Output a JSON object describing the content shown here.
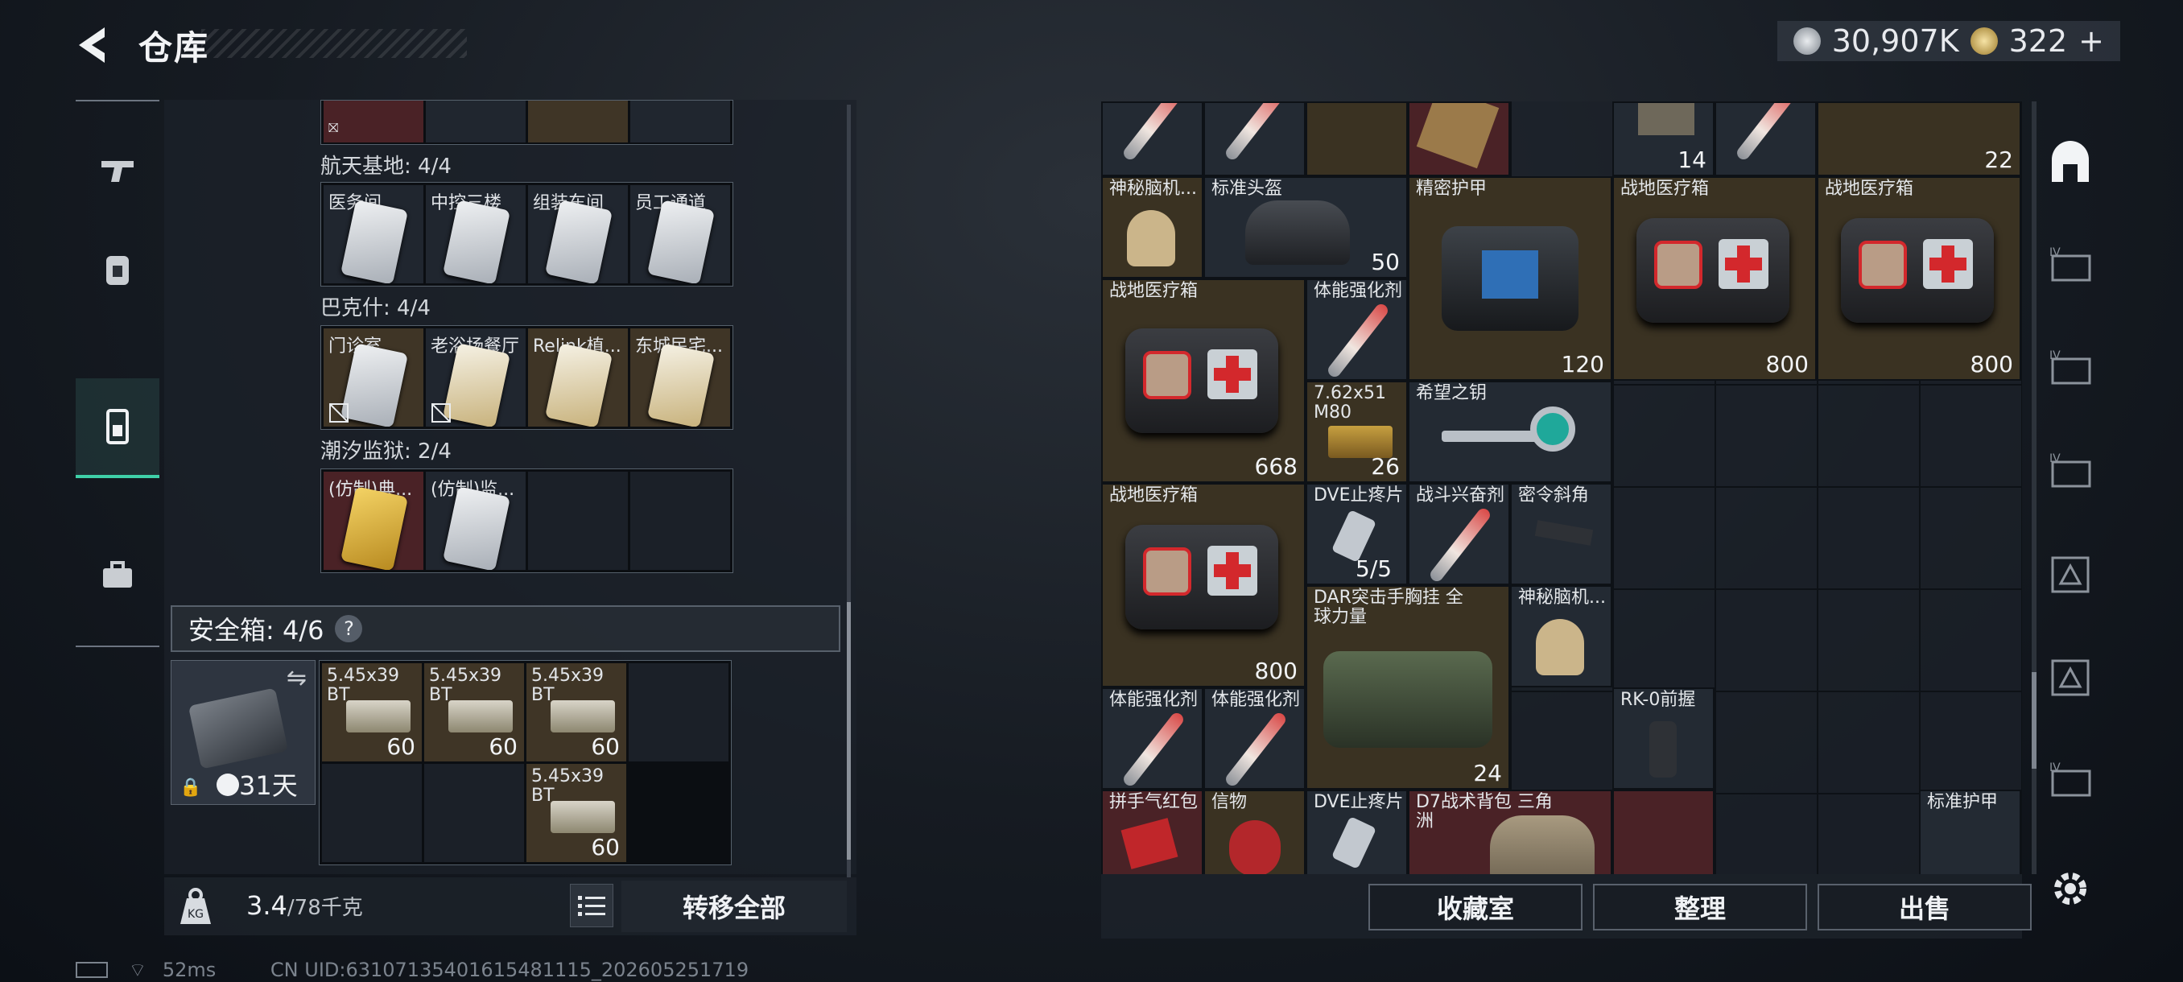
{
  "header": {
    "title": "仓库",
    "currency_a": "30,907K",
    "currency_b": "322",
    "currency_b_plus": "+"
  },
  "left": {
    "sections": [
      {
        "title": "航天基地: 4/4",
        "cells": [
          {
            "label": "医务间",
            "bg": ""
          },
          {
            "label": "中控三楼",
            "bg": ""
          },
          {
            "label": "组装车间",
            "bg": ""
          },
          {
            "label": "员工通道",
            "bg": ""
          }
        ]
      },
      {
        "title": "巴克什: 4/4",
        "cells": [
          {
            "label": "门诊室",
            "bg": "brown",
            "lock": true
          },
          {
            "label": "老浴场餐厅",
            "bg": "",
            "lock": true
          },
          {
            "label": "Relink植...",
            "bg": "brown"
          },
          {
            "label": "东城民宅...",
            "bg": "brown"
          }
        ]
      },
      {
        "title": "潮汐监狱: 2/4",
        "cells": [
          {
            "label": "(仿制)典...",
            "bg": "red"
          },
          {
            "label": "(仿制)监...",
            "bg": ""
          },
          {
            "label": "",
            "bg": "empty"
          },
          {
            "label": "",
            "bg": "empty"
          }
        ]
      }
    ],
    "safe": {
      "title": "安全箱: 4/6",
      "help": "?",
      "days": "31天"
    },
    "ammo": [
      {
        "label": "5.45x39 BT",
        "qty": "60"
      },
      {
        "label": "5.45x39 BT",
        "qty": "60"
      },
      {
        "label": "5.45x39 BT",
        "qty": "60"
      },
      {
        "label": "5.45x39 BT",
        "qty": "60"
      }
    ],
    "weight": "3.4",
    "weight_max": "/78千克",
    "transfer_all": "转移全部"
  },
  "right": {
    "items": {
      "r0_q1": "14",
      "r0_q2": "22",
      "mystic1": "神秘脑机...",
      "helmet": "标准头盔",
      "helmet_q": "50",
      "armor": "精密护甲",
      "armor_q": "120",
      "med1": "战地医疗箱",
      "med1_q": "800",
      "med2": "战地医疗箱",
      "med2_q": "800",
      "med3": "战地医疗箱",
      "med3_q": "668",
      "stim1": "体能强化剂",
      "ammo762": "7.62x51 M80",
      "ammo762_q": "26",
      "key": "希望之钥",
      "med4": "战地医疗箱",
      "med4_q": "800",
      "dve1": "DVE止疼片",
      "dve1_q": "5/5",
      "combat": "战斗兴奋剂",
      "grip1": "密令斜角",
      "vest": "DAR突击手胸挂 全球力量",
      "vest_q": "24",
      "mystic2": "神秘脑机...",
      "stim2": "体能强化剂",
      "stim3": "体能强化剂",
      "grip2": "RK-0前握",
      "redpack": "拼手气红包",
      "token": "信物",
      "dve2": "DVE止疼片",
      "bag": "D7战术背包 三角洲",
      "stdarmor": "标准护甲"
    },
    "buttons": {
      "collection": "收藏室",
      "sort": "整理",
      "sell": "出售"
    }
  },
  "status": {
    "ping": "52ms",
    "uid": "CN UID:63107135401615481115_202605251719"
  },
  "colors": {
    "accent": "#3fd0a8",
    "red_cell": "#4a2226",
    "brown_cell": "#3f3526"
  }
}
